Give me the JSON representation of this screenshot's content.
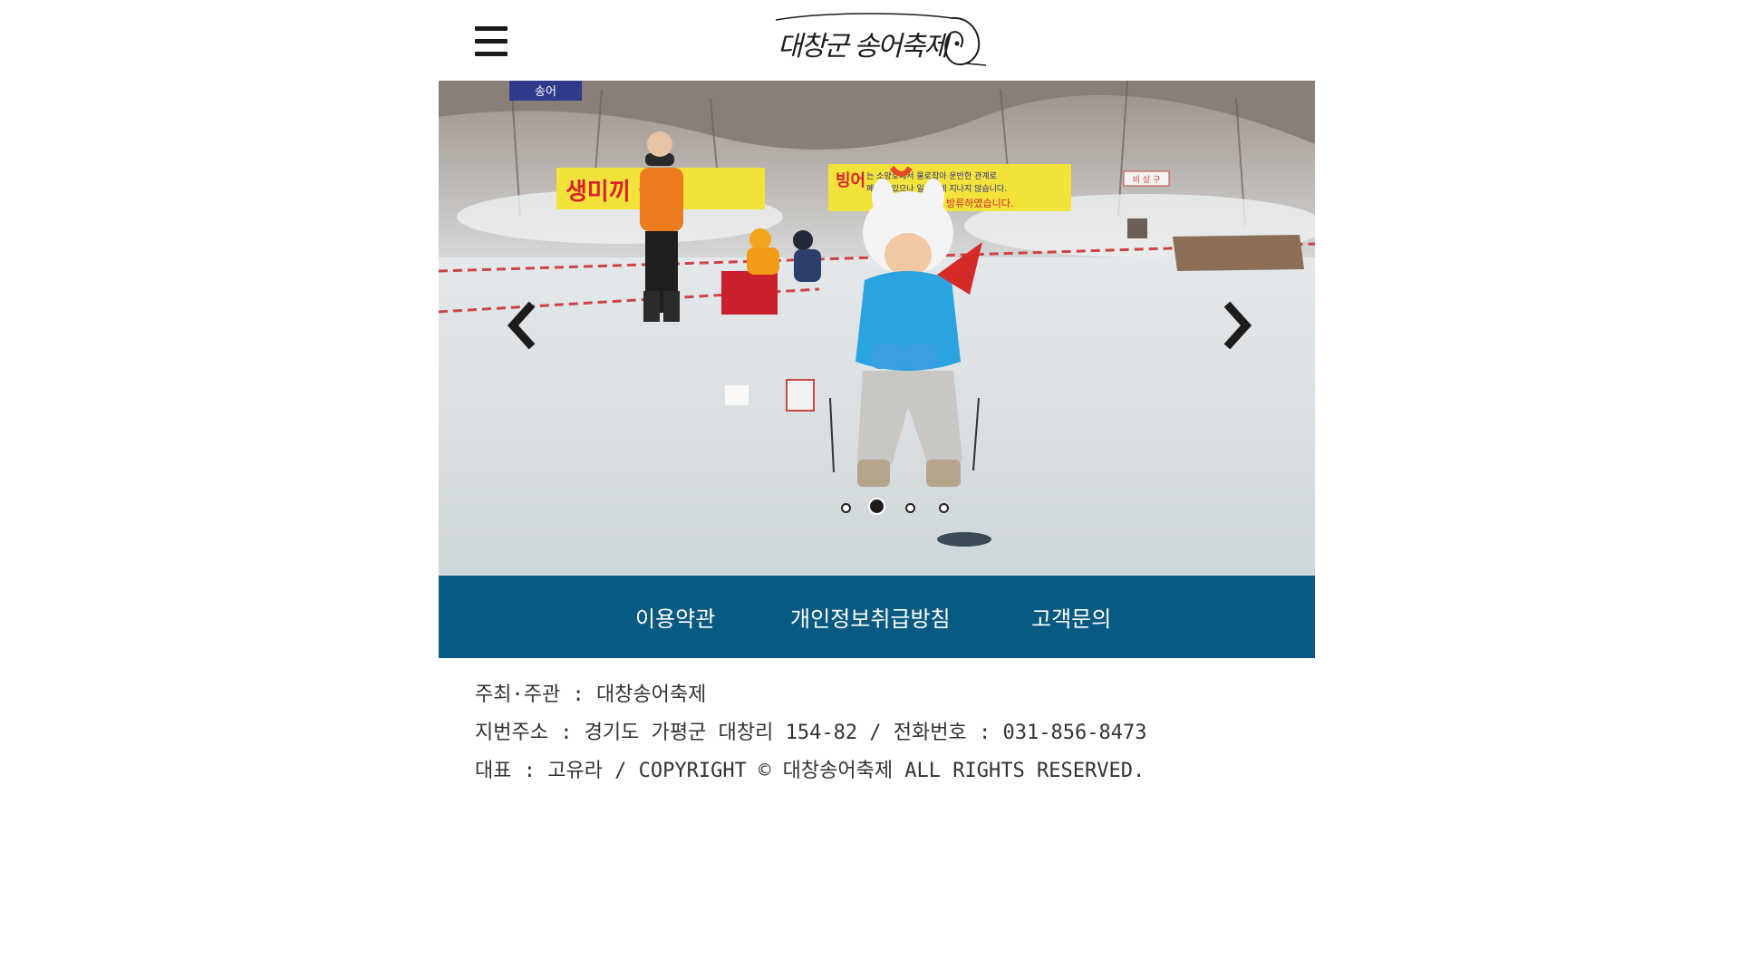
{
  "header": {
    "menu_icon": "hamburger-menu-icon",
    "logo_text": "대창군 송어축제",
    "logo_icon": "fish-icon"
  },
  "slider": {
    "image_alt": "아이가 얼음낚시를 하는 축제 현장",
    "prev_icon": "chevron-left-icon",
    "next_icon": "chevron-right-icon",
    "slide_count": 4,
    "active_slide": 2,
    "banner_left": "생미끼 금지",
    "banner_right_title": "빙어",
    "banner_right_line1": "는 소양호에서 물로잡아 운반한 관계로",
    "banner_right_line2": "폐사가 있으나 일부분에 지나지 않습니다.",
    "banner_right_line3": "방류하였습니다.",
    "sign_small": "비 상 구"
  },
  "footer_nav": {
    "terms": "이용약관",
    "privacy": "개인정보취급방침",
    "contact": "고객문의"
  },
  "info": {
    "line1": "주최·주관 : 대창송어축제",
    "line2": "지번주소 : 경기도 가평군 대창리 154-82  / 전화번호 : 031-856-8473",
    "line3": "대표 : 고유라 / COPYRIGHT © 대창송어축제 ALL RIGHTS RESERVED."
  },
  "colors": {
    "nav_bg": "#095a82",
    "text": "#333333"
  }
}
